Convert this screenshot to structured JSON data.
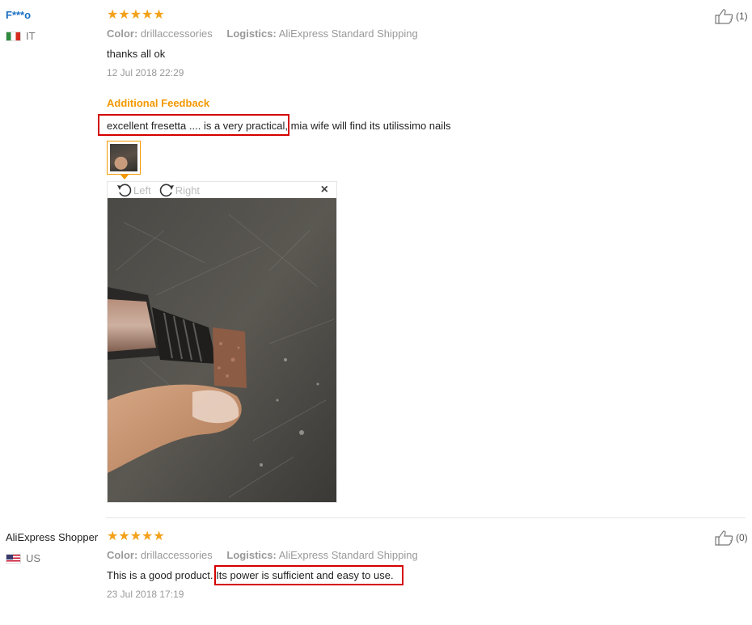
{
  "reviews": [
    {
      "user": "F***o",
      "country": "IT",
      "stars": "★★★★★",
      "color_label": "Color:",
      "color_value": "drillaccessories",
      "logistics_label": "Logistics:",
      "logistics_value": "AliExpress Standard Shipping",
      "text": "thanks all ok",
      "date": "12 Jul 2018 22:29",
      "additional_title": "Additional Feedback",
      "additional_text_highlighted": "excellent fresetta .... is a very practical,",
      "additional_text_rest": " mia wife will find its utilissimo nails",
      "viewer": {
        "rotate_left": "Left",
        "rotate_right": "Right",
        "close": "×"
      },
      "likes": "(1)"
    },
    {
      "user": "AliExpress Shopper",
      "country": "US",
      "stars": "★★★★★",
      "color_label": "Color:",
      "color_value": "drillaccessories",
      "logistics_label": "Logistics:",
      "logistics_value": "AliExpress Standard Shipping",
      "text_plain": "This is a good product.",
      "text_highlighted": " Its power is sufficient and easy to use.",
      "date": "23 Jul 2018 17:19",
      "likes": "(0)"
    }
  ],
  "colors": {
    "star": "#f4a11a",
    "accent": "#f39800",
    "highlight_box": "#d40000",
    "username_blue": "#1a6ec2"
  },
  "icons": [
    "thumbs-up-icon",
    "rotate-left-icon",
    "rotate-right-icon",
    "close-icon",
    "flag-it-icon",
    "flag-us-icon"
  ]
}
